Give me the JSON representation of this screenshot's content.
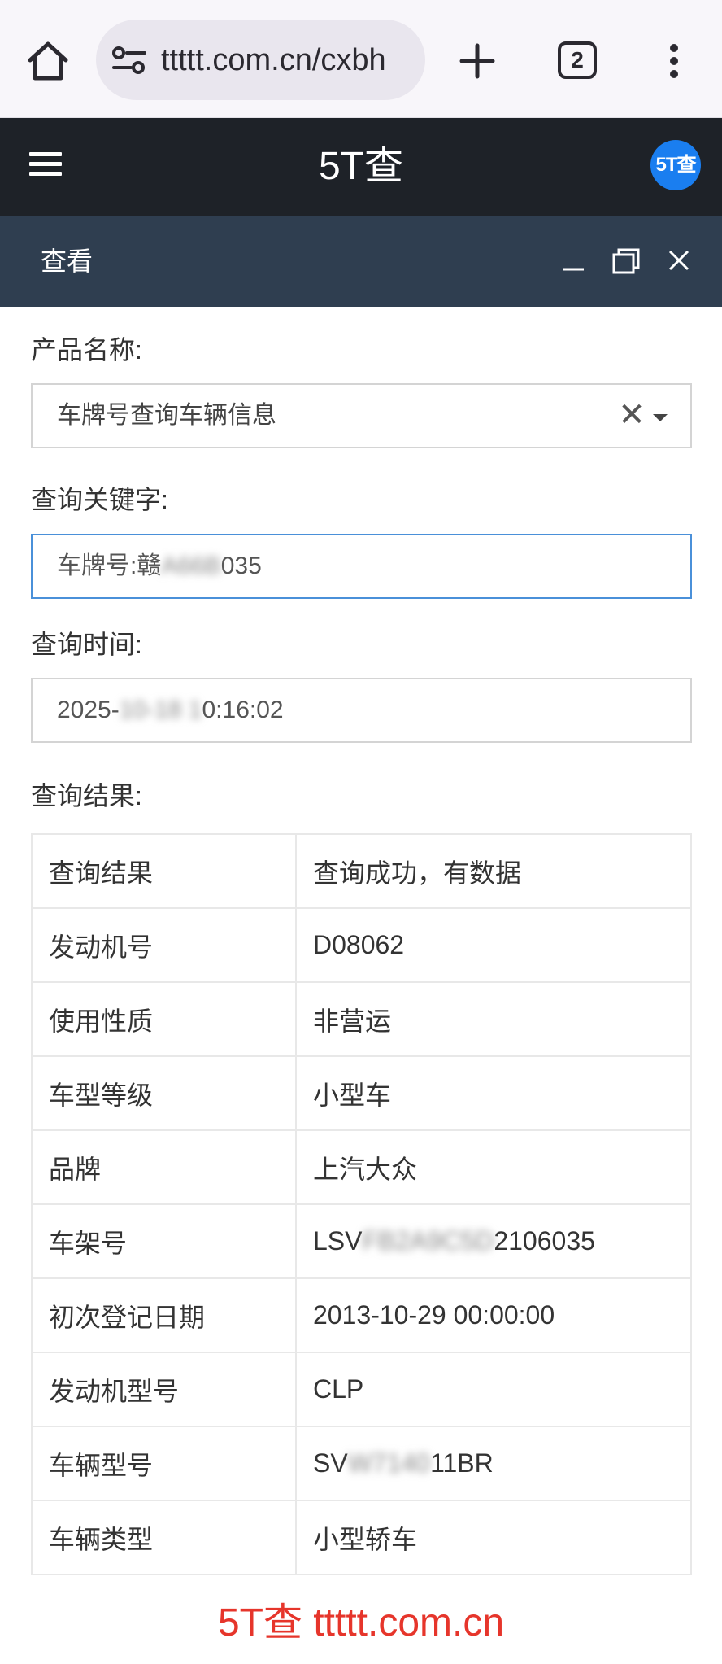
{
  "browser": {
    "url": "ttttt.com.cn/cxbh",
    "tab_count": "2",
    "icons": [
      "home-icon",
      "site-settings-icon",
      "new-tab-icon",
      "tab-switcher-icon",
      "more-menu-icon"
    ]
  },
  "site": {
    "title": "5T查",
    "logo_text": "5T查"
  },
  "dialog": {
    "title": "查看"
  },
  "form": {
    "product_label": "产品名称:",
    "product_value": "车牌号查询车辆信息",
    "clear_symbol": "✕",
    "keyword_label": "查询关键字:",
    "keyword_prefix": "车牌号:赣",
    "keyword_hidden": "A66B",
    "keyword_suffix": "035",
    "time_label": "查询时间:",
    "time_prefix": "2025-",
    "time_hidden": "10-18 1",
    "time_suffix": "0:16:02",
    "result_label": "查询结果:"
  },
  "results": {
    "rows": [
      {
        "key": "查询结果",
        "value": "查询成功，有数据"
      },
      {
        "key": "发动机号",
        "value": "D08062"
      },
      {
        "key": "使用性质",
        "value": "非营运"
      },
      {
        "key": "车型等级",
        "value": "小型车"
      },
      {
        "key": "品牌",
        "value": "上汽大众"
      },
      {
        "key": "车架号",
        "value_prefix": "LSV",
        "value_hidden": "FB2A9C5D",
        "value_suffix": "2106035"
      },
      {
        "key": "初次登记日期",
        "value": "2013-10-29 00:00:00"
      },
      {
        "key": "发动机型号",
        "value": "CLP"
      },
      {
        "key": "车辆型号",
        "value_prefix": "SV",
        "value_hidden": "W7140",
        "value_suffix": "11BR"
      },
      {
        "key": "车辆类型",
        "value": "小型轿车"
      }
    ]
  },
  "footer": {
    "brand": "5T查  ttttt.com.cn"
  },
  "colors": {
    "site_header_bg": "#1e2228",
    "dialog_header_bg": "#2f3e50",
    "logo_bg": "#1a7ef0",
    "footer_brand": "#e6352b",
    "focus_border": "#4a90d9"
  }
}
